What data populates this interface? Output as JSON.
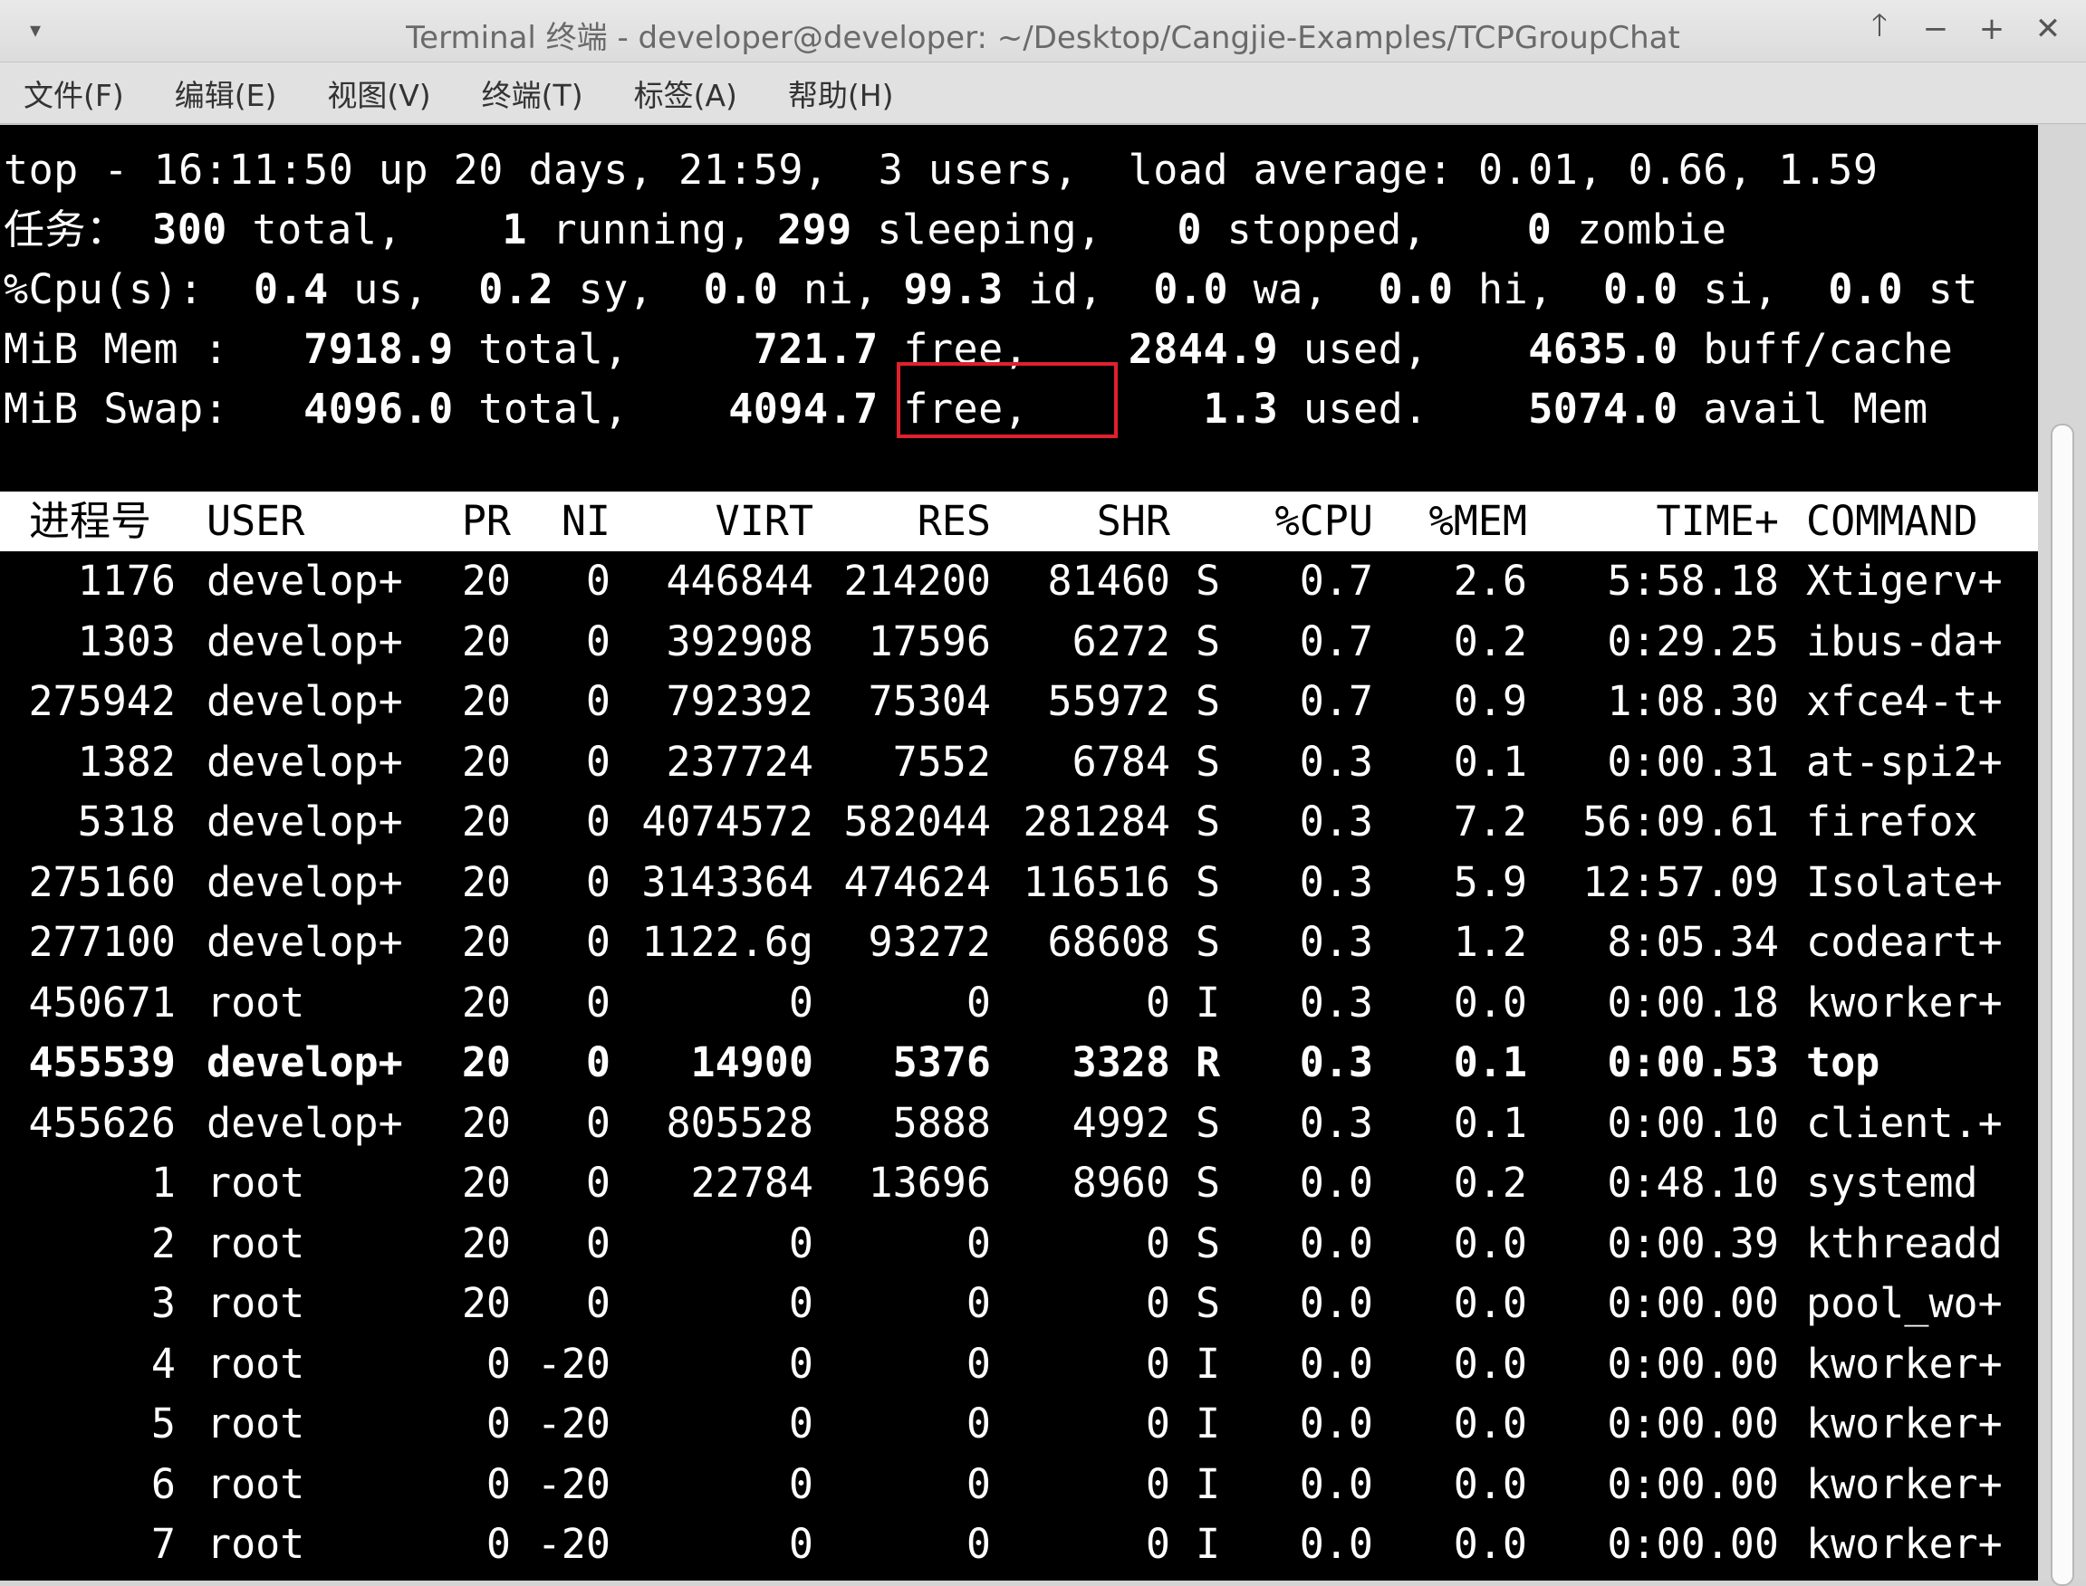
{
  "window": {
    "title": "Terminal 终端 - developer@developer: ~/Desktop/Cangjie-Examples/TCPGroupChat",
    "menu_icon": "chevron-down-icon",
    "controls": [
      "🡑",
      "−",
      "+",
      "✕"
    ]
  },
  "menubar": {
    "items": [
      "文件(F)",
      "编辑(E)",
      "视图(V)",
      "终端(T)",
      "标签(A)",
      "帮助(H)"
    ]
  },
  "summary": {
    "top": {
      "prefix": "top - ",
      "time": "16:11:50",
      "up": " up 20 days, 21:59,  3 users,  load average: ",
      "load": "0.01, 0.66, 1.59"
    },
    "tasks": {
      "label": "任务：",
      "total": "300",
      "total_label": " total,",
      "running": "1",
      "running_label": " running,",
      "sleeping": "299",
      "sleeping_label": " sleeping,",
      "stopped": "0",
      "stopped_label": " stopped,",
      "zombie": "0",
      "zombie_label": " zombie"
    },
    "cpu": {
      "label": "%Cpu(s):",
      "us": "0.4",
      "sy": "0.2",
      "ni": "0.0",
      "id": "99.3",
      "wa": "0.0",
      "hi": "0.0",
      "si": "0.0",
      "st": "0.0"
    },
    "mem": {
      "label": "MiB Mem :",
      "total": "7918.9",
      "free": "721.7",
      "used": "2844.9",
      "buff": "4635.0"
    },
    "swap": {
      "label": "MiB Swap:",
      "total": "4096.0",
      "free": "4094.7",
      "used": "1.3",
      "avail": "5074.0"
    }
  },
  "table": {
    "columns": [
      "进程号",
      "USER",
      "PR",
      "NI",
      "VIRT",
      "RES",
      "SHR",
      "S",
      "%CPU",
      "%MEM",
      "TIME+",
      "COMMAND"
    ],
    "rows": [
      {
        "pid": "1176",
        "user": "develop+",
        "pr": "20",
        "ni": "0",
        "virt": "446844",
        "res": "214200",
        "shr": "81460",
        "s": "S",
        "cpu": "0.7",
        "mem": "2.6",
        "time": "5:58.18",
        "cmd": "Xtigerv+",
        "bold": false
      },
      {
        "pid": "1303",
        "user": "develop+",
        "pr": "20",
        "ni": "0",
        "virt": "392908",
        "res": "17596",
        "shr": "6272",
        "s": "S",
        "cpu": "0.7",
        "mem": "0.2",
        "time": "0:29.25",
        "cmd": "ibus-da+",
        "bold": false
      },
      {
        "pid": "275942",
        "user": "develop+",
        "pr": "20",
        "ni": "0",
        "virt": "792392",
        "res": "75304",
        "shr": "55972",
        "s": "S",
        "cpu": "0.7",
        "mem": "0.9",
        "time": "1:08.30",
        "cmd": "xfce4-t+",
        "bold": false
      },
      {
        "pid": "1382",
        "user": "develop+",
        "pr": "20",
        "ni": "0",
        "virt": "237724",
        "res": "7552",
        "shr": "6784",
        "s": "S",
        "cpu": "0.3",
        "mem": "0.1",
        "time": "0:00.31",
        "cmd": "at-spi2+",
        "bold": false
      },
      {
        "pid": "5318",
        "user": "develop+",
        "pr": "20",
        "ni": "0",
        "virt": "4074572",
        "res": "582044",
        "shr": "281284",
        "s": "S",
        "cpu": "0.3",
        "mem": "7.2",
        "time": "56:09.61",
        "cmd": "firefox",
        "bold": false
      },
      {
        "pid": "275160",
        "user": "develop+",
        "pr": "20",
        "ni": "0",
        "virt": "3143364",
        "res": "474624",
        "shr": "116516",
        "s": "S",
        "cpu": "0.3",
        "mem": "5.9",
        "time": "12:57.09",
        "cmd": "Isolate+",
        "bold": false
      },
      {
        "pid": "277100",
        "user": "develop+",
        "pr": "20",
        "ni": "0",
        "virt": "1122.6g",
        "res": "93272",
        "shr": "68608",
        "s": "S",
        "cpu": "0.3",
        "mem": "1.2",
        "time": "8:05.34",
        "cmd": "codeart+",
        "bold": false
      },
      {
        "pid": "450671",
        "user": "root",
        "pr": "20",
        "ni": "0",
        "virt": "0",
        "res": "0",
        "shr": "0",
        "s": "I",
        "cpu": "0.3",
        "mem": "0.0",
        "time": "0:00.18",
        "cmd": "kworker+",
        "bold": false
      },
      {
        "pid": "455539",
        "user": "develop+",
        "pr": "20",
        "ni": "0",
        "virt": "14900",
        "res": "5376",
        "shr": "3328",
        "s": "R",
        "cpu": "0.3",
        "mem": "0.1",
        "time": "0:00.53",
        "cmd": "top",
        "bold": true
      },
      {
        "pid": "455626",
        "user": "develop+",
        "pr": "20",
        "ni": "0",
        "virt": "805528",
        "res": "5888",
        "shr": "4992",
        "s": "S",
        "cpu": "0.3",
        "mem": "0.1",
        "time": "0:00.10",
        "cmd": "client.+",
        "bold": false
      },
      {
        "pid": "1",
        "user": "root",
        "pr": "20",
        "ni": "0",
        "virt": "22784",
        "res": "13696",
        "shr": "8960",
        "s": "S",
        "cpu": "0.0",
        "mem": "0.2",
        "time": "0:48.10",
        "cmd": "systemd",
        "bold": false
      },
      {
        "pid": "2",
        "user": "root",
        "pr": "20",
        "ni": "0",
        "virt": "0",
        "res": "0",
        "shr": "0",
        "s": "S",
        "cpu": "0.0",
        "mem": "0.0",
        "time": "0:00.39",
        "cmd": "kthreadd",
        "bold": false
      },
      {
        "pid": "3",
        "user": "root",
        "pr": "20",
        "ni": "0",
        "virt": "0",
        "res": "0",
        "shr": "0",
        "s": "S",
        "cpu": "0.0",
        "mem": "0.0",
        "time": "0:00.00",
        "cmd": "pool_wo+",
        "bold": false
      },
      {
        "pid": "4",
        "user": "root",
        "pr": "0",
        "ni": "-20",
        "virt": "0",
        "res": "0",
        "shr": "0",
        "s": "I",
        "cpu": "0.0",
        "mem": "0.0",
        "time": "0:00.00",
        "cmd": "kworker+",
        "bold": false
      },
      {
        "pid": "5",
        "user": "root",
        "pr": "0",
        "ni": "-20",
        "virt": "0",
        "res": "0",
        "shr": "0",
        "s": "I",
        "cpu": "0.0",
        "mem": "0.0",
        "time": "0:00.00",
        "cmd": "kworker+",
        "bold": false
      },
      {
        "pid": "6",
        "user": "root",
        "pr": "0",
        "ni": "-20",
        "virt": "0",
        "res": "0",
        "shr": "0",
        "s": "I",
        "cpu": "0.0",
        "mem": "0.0",
        "time": "0:00.00",
        "cmd": "kworker+",
        "bold": false
      },
      {
        "pid": "7",
        "user": "root",
        "pr": "0",
        "ni": "-20",
        "virt": "0",
        "res": "0",
        "shr": "0",
        "s": "I",
        "cpu": "0.0",
        "mem": "0.0",
        "time": "0:00.00",
        "cmd": "kworker+",
        "bold": false
      }
    ]
  }
}
